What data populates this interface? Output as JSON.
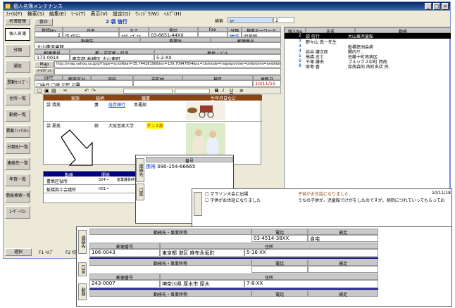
{
  "window": {
    "title": "個人名簿メンテナンス",
    "min": "_",
    "max": "□",
    "close": "×"
  },
  "menu": [
    "ﾌｧｲﾙ(F)",
    "検索(S)",
    "編集(E)",
    "ﾂｰﾙ(T)",
    "表示(V)",
    "設定(O)",
    "ｳｨﾝﾄﾞｳ(W)",
    "ﾍﾙﾌﾟ(H)"
  ],
  "sidebar": {
    "top": "名簿管理",
    "items": [
      "個人名簿",
      "分類",
      "通信",
      "異動ｾｯﾄｺﾞｰ",
      "住所一覧",
      "勤務一覧",
      "異動ﾌｪｯｸｽﾄﾚ",
      "分類別一覧",
      "連絡先一覧",
      "年賀一覧",
      "簡易検索一覧",
      "ﾕｰｻﾞｰﾘｽﾄ"
    ],
    "bottom": "選択"
  },
  "toolbar": {
    "modify": "修正",
    "record_no": "2",
    "name_display": "袋 信行",
    "search_label": "検索",
    "search_value": "ｶﾅ",
    "page": "2"
  },
  "main_table": {
    "headers": [
      "登録No",
      "氏名",
      "カナ",
      "電話",
      "Fax",
      "分類",
      "検索キーワード"
    ],
    "values": [
      "2",
      "袋 信行",
      "ﾌｸﾛ ﾉﾌﾞﾕｷ",
      "03-6651-44XX",
      "",
      "地域",
      "児童館"
    ]
  },
  "work": {
    "headers": [
      "勤務先",
      "事業所",
      "郵便番号"
    ],
    "company": "大山東児童館"
  },
  "address": {
    "headers": [
      "郵便番号",
      "都・市区郡・町名",
      "番地・ビル"
    ],
    "values": [
      "173-0014",
      "東京都 板橋区 大山東町",
      "5-2-XX"
    ]
  },
  "map": {
    "label": "Map URL",
    "url": "http://map.yahoo.co.jp/pl?type=scroll&lat=35.74428198&lon=139.70947854&sc=1&mode=map&pointer=on&home=on&hlat=35.7450647"
  },
  "mail_label": "ﾒｰﾙｱﾄﾞﾚｽ",
  "misc": {
    "headers": [
      "GIFT",
      "贈答区分",
      "旅中",
      "市町村",
      "補足",
      "更新日"
    ],
    "checks": [
      "中元",
      "歳",
      "年",
      "暑"
    ],
    "update": "10/11/15"
  },
  "family": {
    "headers": [
      "家族",
      "続柄",
      "職業",
      "生年月日など"
    ],
    "rows": [
      {
        "name": "袋 清美",
        "rel": "妻",
        "job_a": "証券銀行",
        "job_b": "本運部"
      },
      {
        "name": "袋 夏美",
        "rel": "娘",
        "job_a": "大阪音楽大学",
        "job_b": "ダンス部"
      }
    ]
  },
  "list": {
    "headers": [
      "個人No",
      "氏名",
      "勤務"
    ],
    "rows": [
      {
        "no": "2",
        "name": "袋 信行",
        "work": "大山東児童館"
      },
      {
        "no": "3",
        "name": "野々山 真一先生",
        "work": ""
      },
      {
        "no": "4",
        "name": "",
        "work": "板橋徳洲会病"
      },
      {
        "no": "4",
        "name": "岩井 謙次郎",
        "work": "関内サ..."
      },
      {
        "no": "5",
        "name": "高橋 忠士",
        "work": "佐藤十町南病区"
      },
      {
        "no": "6",
        "name": "千塚 謙夫",
        "work": "ブルックス中町 西南"
      },
      {
        "no": "8",
        "name": "原島 香",
        "work": "厚南森的 南町支店 民"
      }
    ]
  },
  "related": {
    "headers": [
      "勤務",
      "関係"
    ],
    "rows": [
      {
        "name": "豊島区役所",
        "rel": "S24〜",
        "note": "産業課長時代"
      },
      {
        "name": "板橋商工会議所",
        "rel": "H01〜",
        "note": "商工会議所"
      }
    ]
  },
  "phone_panel": {
    "header": "番号",
    "type": "携帯",
    "number": "090-154-66665",
    "tabs": [
      "連絡先",
      "口座"
    ]
  },
  "notes_panel": {
    "items": [
      "マラソン大会に出場",
      "子供がお世話になりました"
    ],
    "title": "子供がお世話になりました",
    "date": "10/11/18",
    "body": "うちの子供が、児童館でけがをしたのですが、病院につれていってもらってお"
  },
  "work_panel": {
    "sections": [
      {
        "headers": [
          "勤務先・事業所等",
          "電話",
          "補足"
        ],
        "phone": "03-4514-38XX",
        "note": "自宅",
        "addr_headers": [
          "郵便番号",
          "住所"
        ],
        "zip": "106-0043",
        "addr": "東京都 港区 麻布永坂町",
        "number": "5-16-XX"
      },
      {
        "headers": [
          "勤務先・事業所等",
          "電話",
          "補足"
        ],
        "phone": "",
        "note": "",
        "addr_headers": [
          "郵便番号",
          "住所"
        ],
        "zip": "243-0007",
        "addr": "神奈川県 厚木市 厚木",
        "number": "7-8-XX"
      },
      {
        "headers": [
          "勤務先・事業所等",
          "電話",
          "補足"
        ]
      }
    ],
    "tabs": [
      "連絡先",
      "口座",
      "勤務"
    ]
  },
  "status": {
    "f1": "F1 ﾍﾙﾌﾟ",
    "f2": "F2 切替"
  }
}
